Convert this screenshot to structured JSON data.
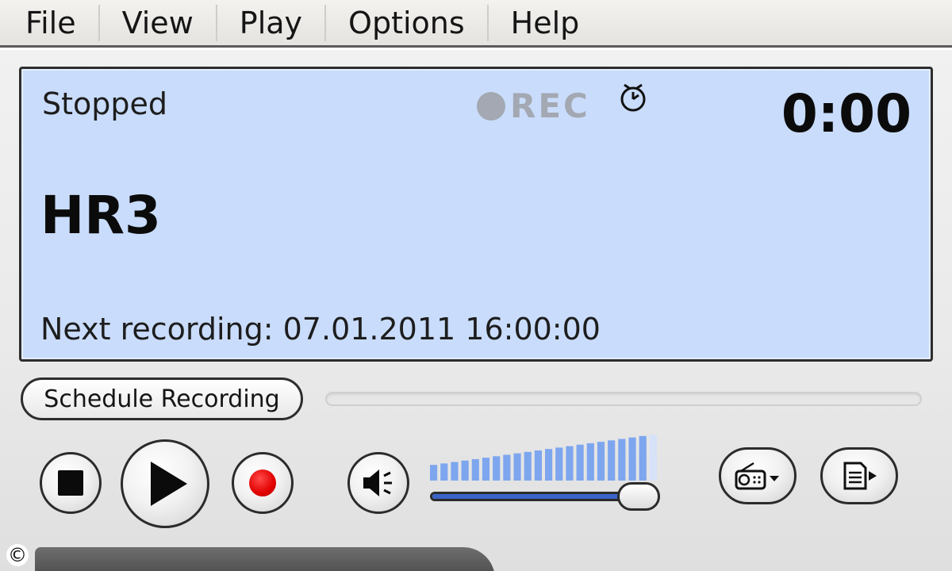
{
  "menu": {
    "items": [
      {
        "label": "File"
      },
      {
        "label": "View"
      },
      {
        "label": "Play"
      },
      {
        "label": "Options"
      },
      {
        "label": "Help"
      }
    ]
  },
  "display": {
    "status": "Stopped",
    "rec_label": "REC",
    "time": "0:00",
    "station": "HR3",
    "next_recording": "Next recording: 07.01.2011 16:00:00",
    "background": "#c9dcfb"
  },
  "controls": {
    "schedule_button": "Schedule Recording",
    "record_color": "#e10000",
    "volume_level": 0.92,
    "volume_bar_color": "#7ea6ef",
    "volume_fill_color": "#3b63c9"
  },
  "icons": {
    "stop": "stop-icon",
    "play": "play-icon",
    "record": "record-icon",
    "mute": "speaker-icon",
    "radio": "radio-icon",
    "playlist": "playlist-icon",
    "timer": "alarm-clock-icon"
  },
  "footer": {
    "copyright": "©"
  }
}
